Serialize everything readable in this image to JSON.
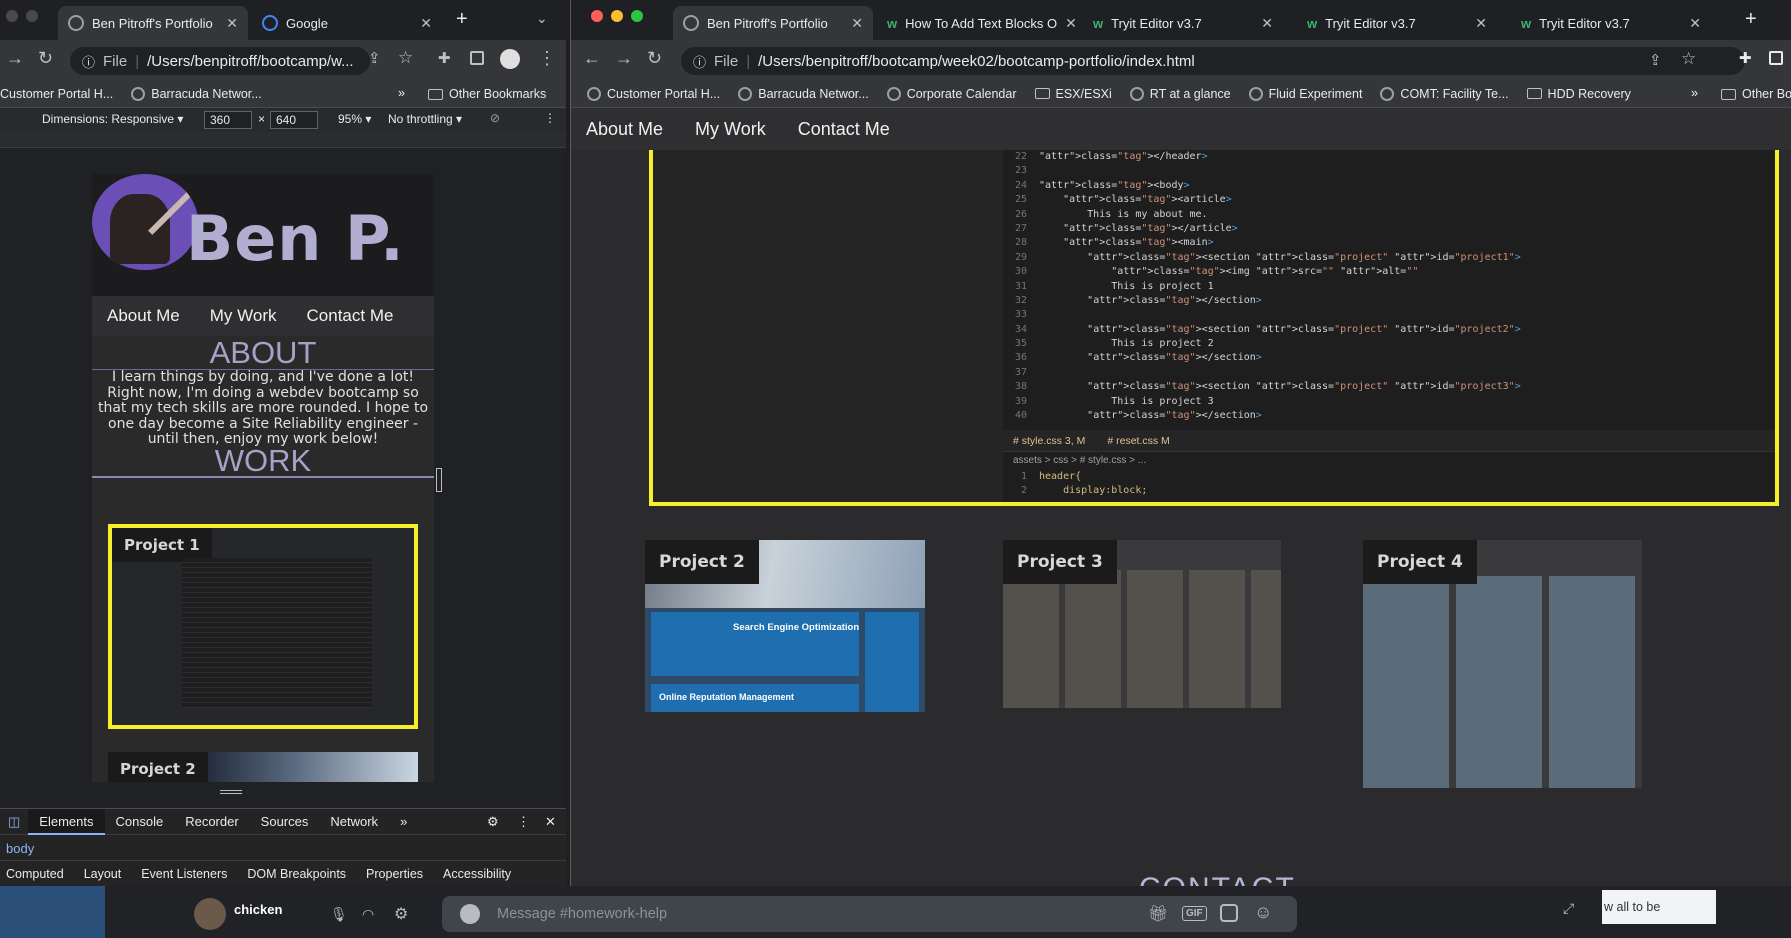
{
  "left_window": {
    "tabs": [
      {
        "title": "Ben Pitroff's Portfolio"
      },
      {
        "title": "Google"
      }
    ],
    "address": {
      "scheme": "File",
      "url": "/Users/benpitroff/bootcamp/w..."
    },
    "bookmarks": [
      "Customer Portal H...",
      "Barracuda Networ..."
    ],
    "other_bookmarks": "Other Bookmarks",
    "devtools_bar": {
      "dimensions_label": "Dimensions: Responsive",
      "width": "360",
      "times": "×",
      "height": "640",
      "zoom": "95%",
      "throttle": "No throttling"
    },
    "mobile_page": {
      "name": "Ben P.",
      "nav": [
        "About Me",
        "My Work",
        "Contact Me"
      ],
      "about_heading": "ABOUT",
      "about_text": "I learn things by doing, and I've done a lot! Right now, I'm doing a webdev bootcamp so that my tech skills are more rounded. I hope to one day become a Site Reliability engineer - until then, enjoy my work below!",
      "work_heading": "WORK",
      "project_1": "Project 1",
      "project_2": "Project 2"
    },
    "devtools": {
      "tabs": [
        "Elements",
        "Console",
        "Recorder",
        "Sources",
        "Network"
      ],
      "more": "»",
      "selected_node": "body",
      "subtabs": [
        "Computed",
        "Layout",
        "Event Listeners",
        "DOM Breakpoints",
        "Properties",
        "Accessibility"
      ]
    }
  },
  "right_window": {
    "tabs": [
      {
        "title": "Ben Pitroff's Portfolio"
      },
      {
        "title": "How To Add Text Blocks O"
      },
      {
        "title": "Tryit Editor v3.7"
      },
      {
        "title": "Tryit Editor v3.7"
      },
      {
        "title": "Tryit Editor v3.7"
      }
    ],
    "address": {
      "scheme": "File",
      "url": "/Users/benpitroff/bootcamp/week02/bootcamp-portfolio/index.html"
    },
    "bookmarks": [
      "Customer Portal H...",
      "Barracuda Networ...",
      "Corporate Calendar",
      "ESX/ESXi",
      "RT at a glance",
      "Fluid Experiment",
      "COMT: Facility Te...",
      "HDD Recovery"
    ],
    "more_bookmarks": "»",
    "other_bookmarks": "Other Bo",
    "page": {
      "nav": [
        "About Me",
        "My Work",
        "Contact Me"
      ],
      "code_lines": [
        {
          "n": "22",
          "html": "</header>"
        },
        {
          "n": "23",
          "html": ""
        },
        {
          "n": "24",
          "html": "<body>"
        },
        {
          "n": "25",
          "html": "    <article>"
        },
        {
          "n": "26",
          "html": "        This is my about me."
        },
        {
          "n": "27",
          "html": "    </article>"
        },
        {
          "n": "28",
          "html": "    <main>"
        },
        {
          "n": "29",
          "html": "        <section class=\"project\" id=\"project1\">"
        },
        {
          "n": "30",
          "html": "            <img src=\"\" alt=\"\""
        },
        {
          "n": "31",
          "html": "            This is project 1"
        },
        {
          "n": "32",
          "html": "        </section>"
        },
        {
          "n": "33",
          "html": ""
        },
        {
          "n": "34",
          "html": "        <section class=\"project\" id=\"project2\">"
        },
        {
          "n": "35",
          "html": "            This is project 2"
        },
        {
          "n": "36",
          "html": "        </section>"
        },
        {
          "n": "37",
          "html": ""
        },
        {
          "n": "38",
          "html": "        <section class=\"project\" id=\"project3\">"
        },
        {
          "n": "39",
          "html": "            This is project 3"
        },
        {
          "n": "40",
          "html": "        </section>"
        }
      ],
      "css_tabs": [
        "# style.css 3, M",
        "# reset.css M"
      ],
      "css_path": "assets > css > # style.css > ...",
      "css_lines": [
        {
          "n": "1",
          "text": "header{"
        },
        {
          "n": "2",
          "text": "    display:block;"
        }
      ],
      "projects": [
        "Project 2",
        "Project 3",
        "Project 4"
      ],
      "project2_tile_titles": [
        "Search Engine Optimization",
        "Online Reputation Management"
      ],
      "contact_heading": "CONTACT"
    }
  },
  "discord": {
    "username": "chicken",
    "message_placeholder": "Message #homework-help",
    "toast_text": "w all to be"
  },
  "colors": {
    "accent_yellow": "#f5f02a",
    "heading_lavender": "#a4a2c8"
  }
}
